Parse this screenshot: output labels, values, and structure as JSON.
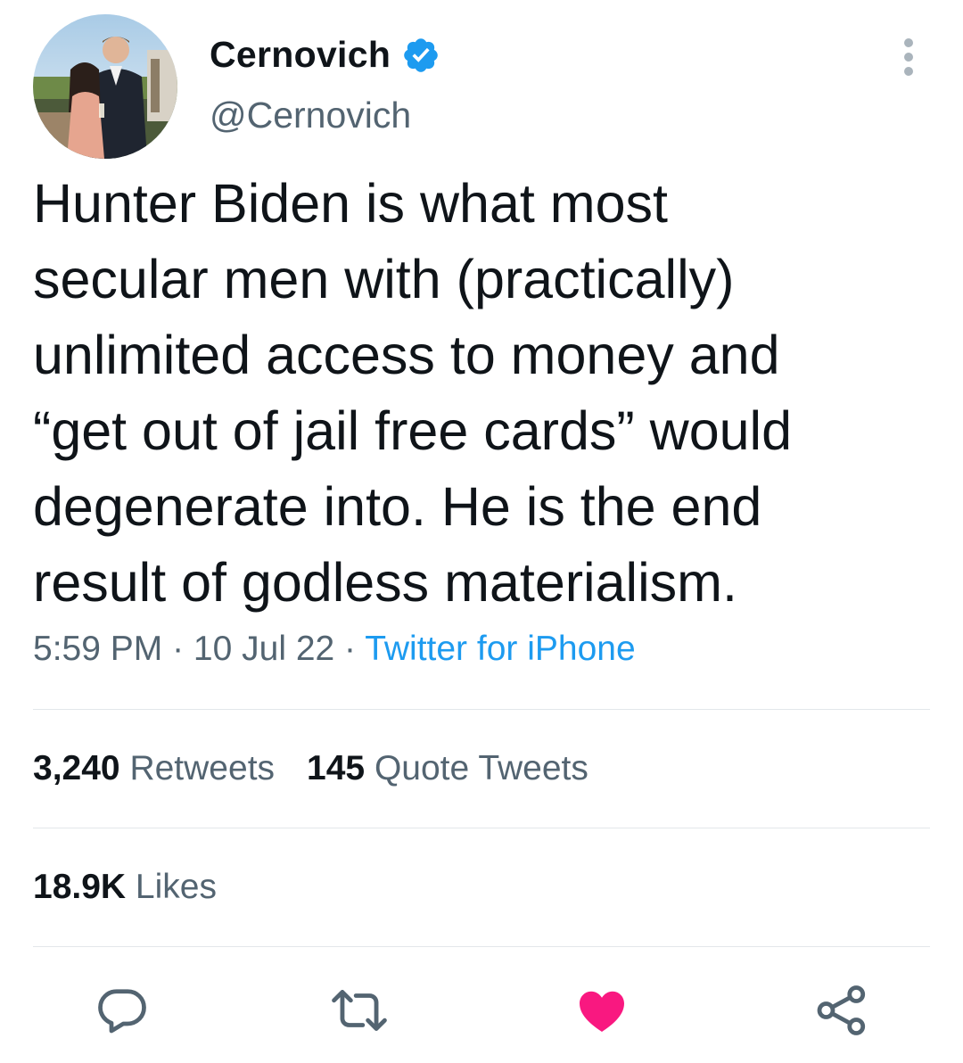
{
  "author": {
    "name": "Cernovich",
    "handle": "@Cernovich",
    "verified_icon": "verified-badge-icon",
    "avatar_icon": "profile-photo"
  },
  "tweet": {
    "text": "Hunter Biden is what most\nsecular men with (practically)\nunlimited access to money and\n“get out of jail free cards” would\ndegenerate into. He is the end\nresult of godless materialism.",
    "time": "5:59 PM",
    "date": "10 Jul 22",
    "separator": " · ",
    "source": "Twitter for iPhone"
  },
  "stats": {
    "retweets_count": "3,240",
    "retweets_label": "Retweets",
    "quotes_count": "145",
    "quotes_label": "Quote Tweets",
    "likes_count": "18.9K",
    "likes_label": "Likes"
  },
  "actions": [
    {
      "icon": "reply-icon"
    },
    {
      "icon": "retweet-icon"
    },
    {
      "icon": "like-icon",
      "active": true
    },
    {
      "icon": "share-icon"
    }
  ],
  "colors": {
    "text": "#0f1419",
    "secondary": "#536471",
    "link": "#1d9bf0",
    "verified": "#1d9bf0",
    "like_active": "#f91880",
    "divider": "#e3e7ea"
  }
}
